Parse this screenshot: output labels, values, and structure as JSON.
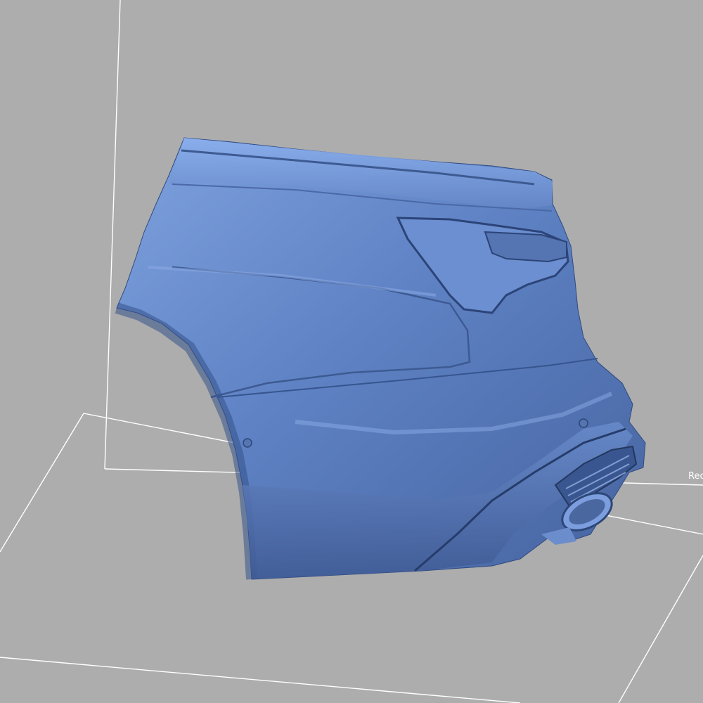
{
  "viewport": {
    "background_color": "#adadad",
    "grid_line_color": "#ffffff",
    "mesh_color": "#5e82c4",
    "mesh_highlight_color": "#86a8e6",
    "mesh_shadow_color": "#3f5c99",
    "edge_label": "Rec"
  }
}
